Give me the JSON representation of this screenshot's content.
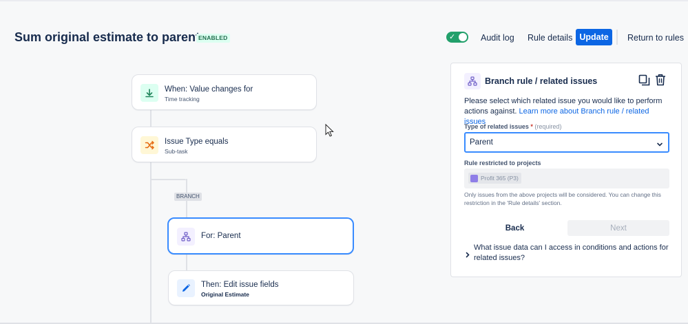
{
  "header": {
    "title": "Sum original estimate to parent",
    "status_badge": "ENABLED",
    "toggle_on": true,
    "audit_log_label": "Audit log",
    "rule_details_label": "Rule details",
    "update_label": "Update",
    "return_label": "Return to rules"
  },
  "flow": {
    "trigger": {
      "title": "When: Value changes for",
      "subtitle": "Time tracking",
      "icon": "download-arrow-icon"
    },
    "condition": {
      "title": "Issue Type equals",
      "subtitle": "Sub-task",
      "icon": "shuffle-icon"
    },
    "branch_label": "BRANCH",
    "branch": {
      "title": "For: Parent",
      "icon": "hierarchy-icon"
    },
    "action": {
      "title": "Then: Edit issue fields",
      "subtitle": "Original Estimate",
      "icon": "pencil-icon"
    }
  },
  "panel": {
    "title": "Branch rule / related issues",
    "desc_text": "Please select which related issue you would like to perform actions against.",
    "desc_link": "Learn more about Branch rule / related issues",
    "related_label": "Type of related issues",
    "required_star": "*",
    "required_text": "(required)",
    "related_value": "Parent",
    "projects_label": "Rule restricted to projects",
    "project_chip": "Profit 365 (P3)",
    "help_text": "Only issues from the above projects will be considered. You can change this restriction in the 'Rule details' section.",
    "back_label": "Back",
    "next_label": "Next",
    "faq_text": "What issue data can I access in conditions and actions for related issues?"
  },
  "colors": {
    "primary": "#0c66e4",
    "toggle_on": "#22a06b",
    "selected_border": "#388bff",
    "trigger_icon_bg": "#dcfff1",
    "condition_icon_bg": "#fff7d6",
    "branch_icon_bg": "#f3f0ff",
    "action_icon_bg": "#e9f2ff"
  }
}
